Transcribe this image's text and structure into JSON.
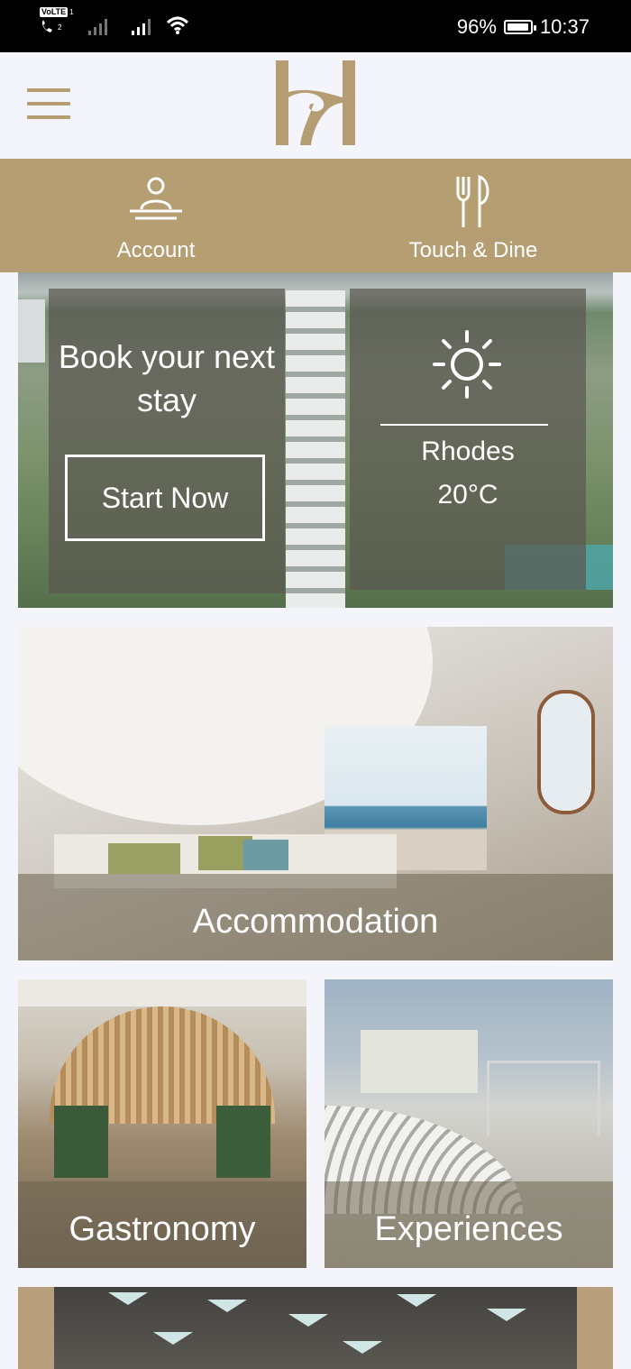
{
  "status_bar": {
    "volte_label": "VoLTE",
    "sim1": "1",
    "sim2": "2",
    "battery": "96%",
    "battery_level": 0.96,
    "time": "10:37"
  },
  "colors": {
    "brand_gold": "#b59e71",
    "background": "#f3f5fa"
  },
  "quick_actions": [
    {
      "label": "Account",
      "icon": "account-desk-icon"
    },
    {
      "label": "Touch & Dine",
      "icon": "fork-knife-icon"
    }
  ],
  "hero": {
    "book_title": "Book your next stay",
    "book_button": "Start Now",
    "weather_icon": "sun-icon",
    "city": "Rhodes",
    "temperature": "20°C"
  },
  "cards": {
    "accommodation": "Accommodation",
    "gastronomy": "Gastronomy",
    "experiences": "Experiences"
  }
}
